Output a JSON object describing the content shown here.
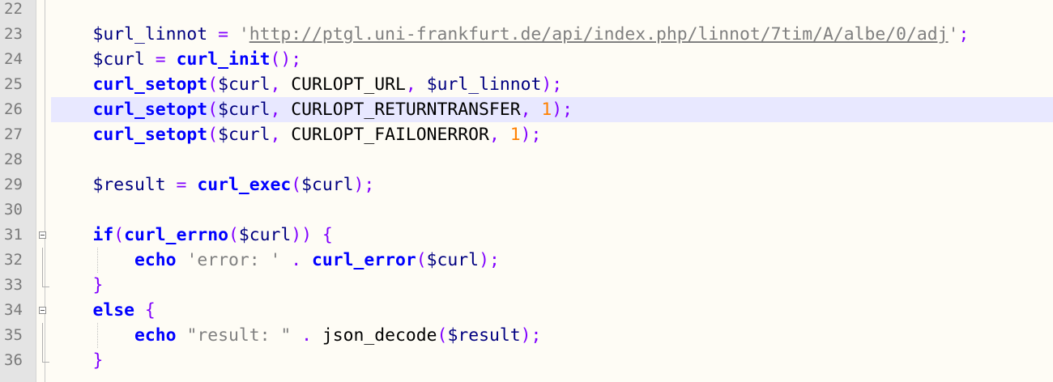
{
  "editor": {
    "lines": [
      {
        "number": "22",
        "fold": "none",
        "tokens": []
      },
      {
        "number": "23",
        "fold": "none",
        "tokens": [
          {
            "t": "    ",
            "c": "plain"
          },
          {
            "t": "$url_linnot",
            "c": "var"
          },
          {
            "t": " = ",
            "c": "op"
          },
          {
            "t": "'",
            "c": "str"
          },
          {
            "t": "http://ptgl.uni-frankfurt.de/api/index.php/linnot/7tim/A/albe/0/adj",
            "c": "url"
          },
          {
            "t": "'",
            "c": "str"
          },
          {
            "t": ";",
            "c": "op"
          }
        ]
      },
      {
        "number": "24",
        "fold": "none",
        "tokens": [
          {
            "t": "    ",
            "c": "plain"
          },
          {
            "t": "$curl",
            "c": "var"
          },
          {
            "t": " = ",
            "c": "op"
          },
          {
            "t": "curl_init",
            "c": "fn"
          },
          {
            "t": "();",
            "c": "op"
          }
        ]
      },
      {
        "number": "25",
        "fold": "none",
        "tokens": [
          {
            "t": "    ",
            "c": "plain"
          },
          {
            "t": "curl_setopt",
            "c": "fn"
          },
          {
            "t": "(",
            "c": "op"
          },
          {
            "t": "$curl",
            "c": "var"
          },
          {
            "t": ", ",
            "c": "op"
          },
          {
            "t": "CURLOPT_URL",
            "c": "plain"
          },
          {
            "t": ", ",
            "c": "op"
          },
          {
            "t": "$url_linnot",
            "c": "var"
          },
          {
            "t": ");",
            "c": "op"
          }
        ]
      },
      {
        "number": "26",
        "fold": "none",
        "current": true,
        "tokens": [
          {
            "t": "    ",
            "c": "plain"
          },
          {
            "t": "curl_setopt",
            "c": "fn"
          },
          {
            "t": "(",
            "c": "op"
          },
          {
            "t": "$curl",
            "c": "var"
          },
          {
            "t": ", ",
            "c": "op"
          },
          {
            "t": "CURLOPT_RETURNTRANSFER",
            "c": "plain"
          },
          {
            "t": ", ",
            "c": "op"
          },
          {
            "t": "1",
            "c": "num"
          },
          {
            "t": ");",
            "c": "op"
          }
        ]
      },
      {
        "number": "27",
        "fold": "none",
        "tokens": [
          {
            "t": "    ",
            "c": "plain"
          },
          {
            "t": "curl_setopt",
            "c": "fn"
          },
          {
            "t": "(",
            "c": "op"
          },
          {
            "t": "$curl",
            "c": "var"
          },
          {
            "t": ", ",
            "c": "op"
          },
          {
            "t": "CURLOPT_FAILONERROR",
            "c": "plain"
          },
          {
            "t": ", ",
            "c": "op"
          },
          {
            "t": "1",
            "c": "num"
          },
          {
            "t": ");",
            "c": "op"
          }
        ]
      },
      {
        "number": "28",
        "fold": "none",
        "tokens": []
      },
      {
        "number": "29",
        "fold": "none",
        "tokens": [
          {
            "t": "    ",
            "c": "plain"
          },
          {
            "t": "$result",
            "c": "var"
          },
          {
            "t": " = ",
            "c": "op"
          },
          {
            "t": "curl_exec",
            "c": "fn"
          },
          {
            "t": "(",
            "c": "op"
          },
          {
            "t": "$curl",
            "c": "var"
          },
          {
            "t": ");",
            "c": "op"
          }
        ]
      },
      {
        "number": "30",
        "fold": "none",
        "tokens": []
      },
      {
        "number": "31",
        "fold": "open",
        "tokens": [
          {
            "t": "    ",
            "c": "plain"
          },
          {
            "t": "if",
            "c": "kw"
          },
          {
            "t": "(",
            "c": "op"
          },
          {
            "t": "curl_errno",
            "c": "fn"
          },
          {
            "t": "(",
            "c": "op"
          },
          {
            "t": "$curl",
            "c": "var"
          },
          {
            "t": ")) {",
            "c": "op"
          }
        ]
      },
      {
        "number": "32",
        "fold": "line",
        "guide": true,
        "tokens": [
          {
            "t": "        ",
            "c": "plain"
          },
          {
            "t": "echo",
            "c": "kw"
          },
          {
            "t": " ",
            "c": "plain"
          },
          {
            "t": "'error: '",
            "c": "str"
          },
          {
            "t": " . ",
            "c": "op"
          },
          {
            "t": "curl_error",
            "c": "fn"
          },
          {
            "t": "(",
            "c": "op"
          },
          {
            "t": "$curl",
            "c": "var"
          },
          {
            "t": ");",
            "c": "op"
          }
        ]
      },
      {
        "number": "33",
        "fold": "end",
        "tokens": [
          {
            "t": "    ",
            "c": "plain"
          },
          {
            "t": "}",
            "c": "op"
          }
        ]
      },
      {
        "number": "34",
        "fold": "open",
        "tokens": [
          {
            "t": "    ",
            "c": "plain"
          },
          {
            "t": "else",
            "c": "kw"
          },
          {
            "t": " {",
            "c": "op"
          }
        ]
      },
      {
        "number": "35",
        "fold": "line",
        "guide": true,
        "tokens": [
          {
            "t": "        ",
            "c": "plain"
          },
          {
            "t": "echo",
            "c": "kw"
          },
          {
            "t": " ",
            "c": "plain"
          },
          {
            "t": "\"result: \"",
            "c": "str"
          },
          {
            "t": " . ",
            "c": "op"
          },
          {
            "t": "json_decode",
            "c": "plain"
          },
          {
            "t": "(",
            "c": "op"
          },
          {
            "t": "$result",
            "c": "var"
          },
          {
            "t": ");",
            "c": "op"
          }
        ]
      },
      {
        "number": "36",
        "fold": "end",
        "tokens": [
          {
            "t": "    ",
            "c": "plain"
          },
          {
            "t": "}",
            "c": "op"
          }
        ]
      }
    ]
  }
}
